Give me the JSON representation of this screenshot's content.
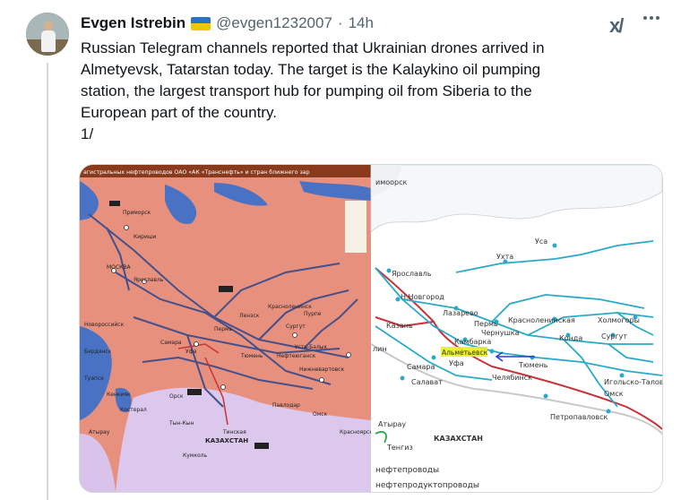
{
  "tweet": {
    "author_name": "Evgen Istrebin",
    "handle": "@evgen1232007",
    "separator": "·",
    "time": "14h",
    "text_lines": [
      "Russian Telegram channels reported that Ukrainian drones arrived in",
      "Almetyevsk, Tatarstan today. The target is the Kalaykino oil pumping",
      "station, the largest transport hub for pumping oil from Siberia to the",
      "European part of the country.",
      "1/"
    ]
  },
  "icons": {
    "avatar": "avatar-photo",
    "flag": "ukraine-flag-icon",
    "grok": "grok-icon",
    "more": "more-options-icon"
  },
  "colors": {
    "text": "#0f1419",
    "secondary": "#536471",
    "border": "#cfd9de",
    "map_left_fill": "#e8907e",
    "map_left_water": "#4a72c4",
    "map_right_line": "#2aa9c9",
    "map_right_red": "#c8323a",
    "highlight": "#e8f020"
  },
  "left_map": {
    "header": "агистральных нефтепроводов ОАО «АК «Транснефть» и стран ближнего зар",
    "labels": [
      "Приморск",
      "Кириши",
      "МОСКВА",
      "Ярославль",
      "Уфа",
      "Орск",
      "Самара",
      "Сургут",
      "Красноленинск",
      "Пурпе",
      "Лензск",
      "Усть-Балык",
      "Нижневартовск",
      "Омск",
      "Павлодар",
      "Костерал",
      "Кумколь",
      "Тинская",
      "КАЗАХСТАН",
      "Новороссийск",
      "Пермь",
      "Нефтеюганск",
      "Тюмень",
      "Кенкияк",
      "Атырау",
      "Туапсе",
      "Бердянск",
      "Красноярск",
      "Тын-Кын"
    ]
  },
  "right_map": {
    "labels": [
      "имоорск",
      "Уса",
      "Ухта",
      "Ярославль",
      "Н.Новгород",
      "Лазарево",
      "Казань",
      "Пермь",
      "Красноленинская",
      "Холмогоры",
      "Сургут",
      "Конда",
      "Камбарка",
      "Чернушка",
      "Альметьевск",
      "Уфа",
      "Самара",
      "Тюмень",
      "Челябинск",
      "Салават",
      "Игольско-Таловое",
      "Омск",
      "Петропавловск",
      "Атырау",
      "Тенгиз",
      "КАЗАХСТАН",
      "нефтепроводы",
      "нефтепродуктопроводы",
      "лин"
    ]
  }
}
